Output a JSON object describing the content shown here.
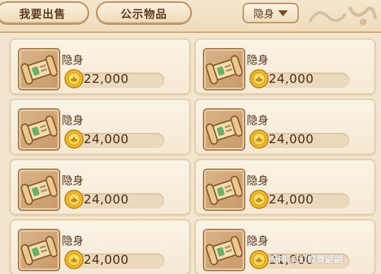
{
  "tabs": {
    "sell_label": "我要出售",
    "public_label": "公示物品"
  },
  "filter": {
    "selected": "隐身"
  },
  "items": [
    {
      "name": "隐身",
      "price": "22,000"
    },
    {
      "name": "隐身",
      "price": "24,000"
    },
    {
      "name": "隐身",
      "price": "24,000"
    },
    {
      "name": "隐身",
      "price": "24,000"
    },
    {
      "name": "隐身",
      "price": "24,000"
    },
    {
      "name": "隐身",
      "price": "24,000"
    },
    {
      "name": "隐身",
      "price": "24,000"
    },
    {
      "name": "隐身",
      "price": "21,000"
    }
  ],
  "watermark": "天神 @幻蝶舞翩翩",
  "colors": {
    "background": "#f3e6cf",
    "card": "#fbf3e6",
    "tab_border": "#b98a54",
    "coin": "#f2c232",
    "text": "#4e3218"
  },
  "icons": {
    "item": "scroll-icon",
    "currency": "gold-coin-icon",
    "dropdown": "triangle-down-icon"
  }
}
